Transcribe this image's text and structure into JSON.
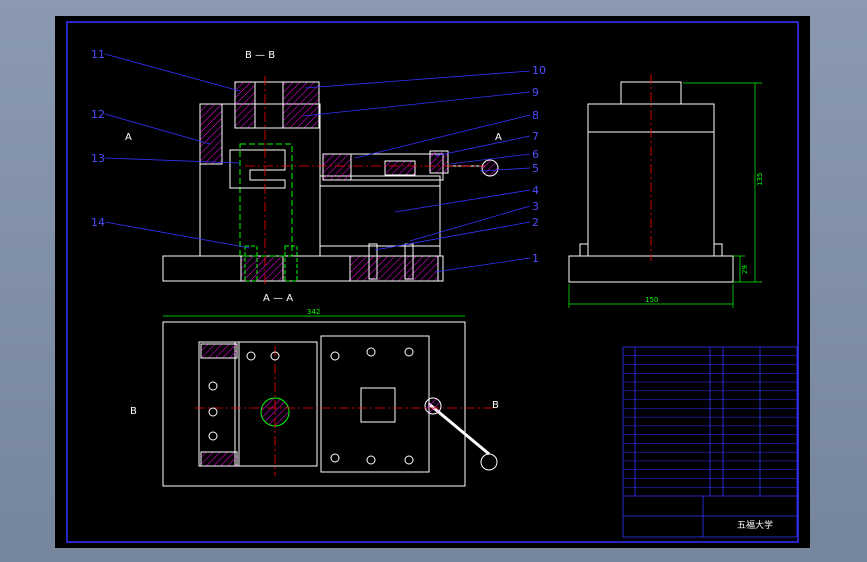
{
  "section_labels": {
    "bb_top": "B — B",
    "aa_left": "A",
    "aa_right": "A",
    "aa_bottom": "A — A",
    "b_left": "B",
    "b_right": "B"
  },
  "balloons": [
    "1",
    "2",
    "3",
    "4",
    "5",
    "6",
    "7",
    "8",
    "9",
    "10",
    "11",
    "12",
    "13",
    "14"
  ],
  "dimensions": {
    "side_height": "135",
    "side_base": "29",
    "side_width": "150",
    "plan_width": "342"
  },
  "title_block": {
    "title": "五福大学",
    "parts_rows": 17
  },
  "colors": {
    "outline": "#ffffff",
    "hatch": "#ff00ff",
    "centerline": "#ff0000",
    "hidden": "#00ff00",
    "leader": "#3333ff",
    "border": "#3333ff"
  }
}
